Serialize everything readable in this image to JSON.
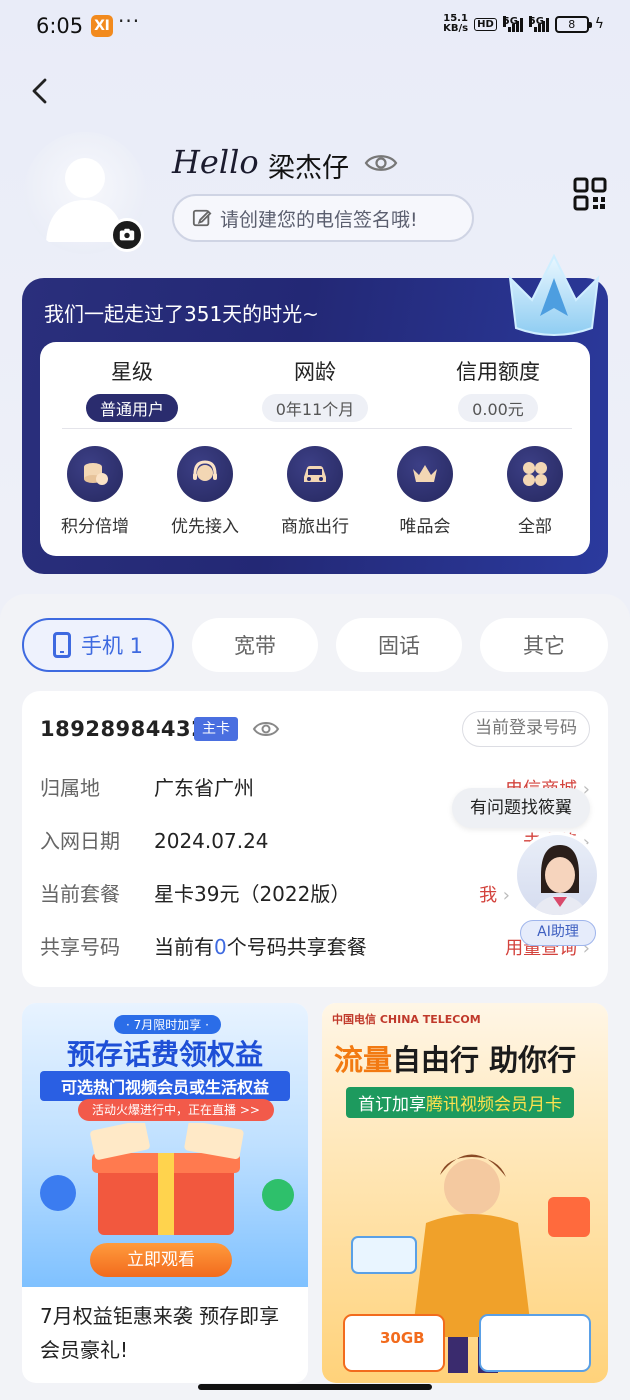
{
  "status_bar": {
    "time": "6:05",
    "net_speed_value": "15.1",
    "net_speed_unit": "KB/s",
    "hd_label": "HD",
    "signal_1_label": "5G",
    "signal_2_label": "5G",
    "battery": "8"
  },
  "profile": {
    "hello": "Hello",
    "name": "梁杰仔",
    "signature_placeholder": "请创建您的电信签名哦!"
  },
  "member_card": {
    "tagline": "我们一起走过了351天的时光~",
    "stats": [
      {
        "label": "星级",
        "value": "普通用户"
      },
      {
        "label": "网龄",
        "value": "0年11个月"
      },
      {
        "label": "信用额度",
        "value": "0.00元"
      }
    ],
    "benefits": [
      {
        "label": "积分倍增",
        "icon": "coins-icon"
      },
      {
        "label": "优先接入",
        "icon": "headset-icon"
      },
      {
        "label": "商旅出行",
        "icon": "car-icon"
      },
      {
        "label": "唯品会",
        "icon": "crown-icon"
      },
      {
        "label": "全部",
        "icon": "grid-icon"
      }
    ]
  },
  "tabs": [
    {
      "label": "手机 1"
    },
    {
      "label": "宽带"
    },
    {
      "label": "固话"
    },
    {
      "label": "其它"
    }
  ],
  "account": {
    "phone_number": "18928984432",
    "main_badge": "主卡",
    "login_badge": "当前登录号码",
    "rows": [
      {
        "label": "归属地",
        "value": "广东省广州",
        "link": "电信商城"
      },
      {
        "label": "入网日期",
        "value": "2024.07.24",
        "link": "去充值"
      },
      {
        "label": "当前套餐",
        "value": "星卡39元（2022版）",
        "link": "我"
      },
      {
        "label": "共享号码",
        "value_prefix": "当前有",
        "value_count": "0",
        "value_suffix": "个号码共享套餐",
        "link": "用量查询"
      }
    ]
  },
  "assistant": {
    "bubble": "有问题找筱翼",
    "label": "AI助理"
  },
  "promos": [
    {
      "tag": "· 7月限时加享 ·",
      "title": "预存话费领权益",
      "subtitle": "可选热门视频会员或生活权益",
      "live": "活动火爆进行中，正在直播 >>",
      "cta": "立即观看",
      "caption": "7月权益钜惠来袭 预存即享会员豪礼!"
    },
    {
      "brand": "中国电信 CHINA TELECOM",
      "title_a": "流量",
      "title_b": "自由行 助你行",
      "sub_a": "首订加享",
      "sub_b": "腾讯视频会员月卡",
      "data_pack": "30GB"
    }
  ],
  "colors": {
    "accent": "#3e6ae0",
    "card_navy": "#262a78",
    "link_red": "#d3423c"
  }
}
